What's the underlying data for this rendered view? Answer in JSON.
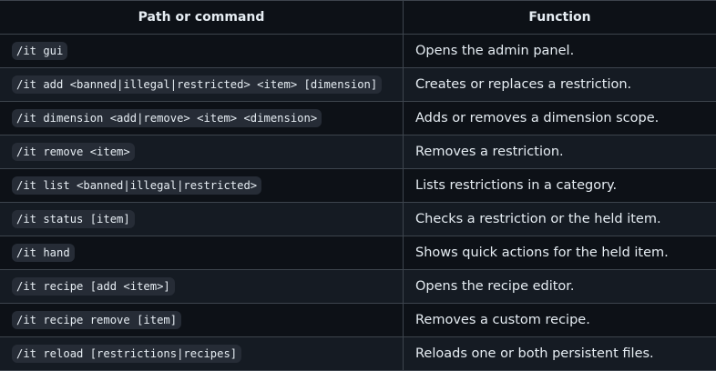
{
  "table": {
    "headers": [
      "Path or command",
      "Function"
    ],
    "rows": [
      {
        "command": "/it gui",
        "function": "Opens the admin panel."
      },
      {
        "command": "/it add <banned|illegal|restricted> <item> [dimension]",
        "function": "Creates or replaces a restriction."
      },
      {
        "command": "/it dimension <add|remove> <item> <dimension>",
        "function": "Adds or removes a dimension scope."
      },
      {
        "command": "/it remove <item>",
        "function": "Removes a restriction."
      },
      {
        "command": "/it list <banned|illegal|restricted>",
        "function": "Lists restrictions in a category."
      },
      {
        "command": "/it status [item]",
        "function": "Checks a restriction or the held item."
      },
      {
        "command": "/it hand",
        "function": "Shows quick actions for the held item."
      },
      {
        "command": "/it recipe [add <item>]",
        "function": "Opens the recipe editor."
      },
      {
        "command": "/it recipe remove [item]",
        "function": "Removes a custom recipe."
      },
      {
        "command": "/it reload [restrictions|recipes]",
        "function": "Reloads one or both persistent files."
      }
    ]
  }
}
